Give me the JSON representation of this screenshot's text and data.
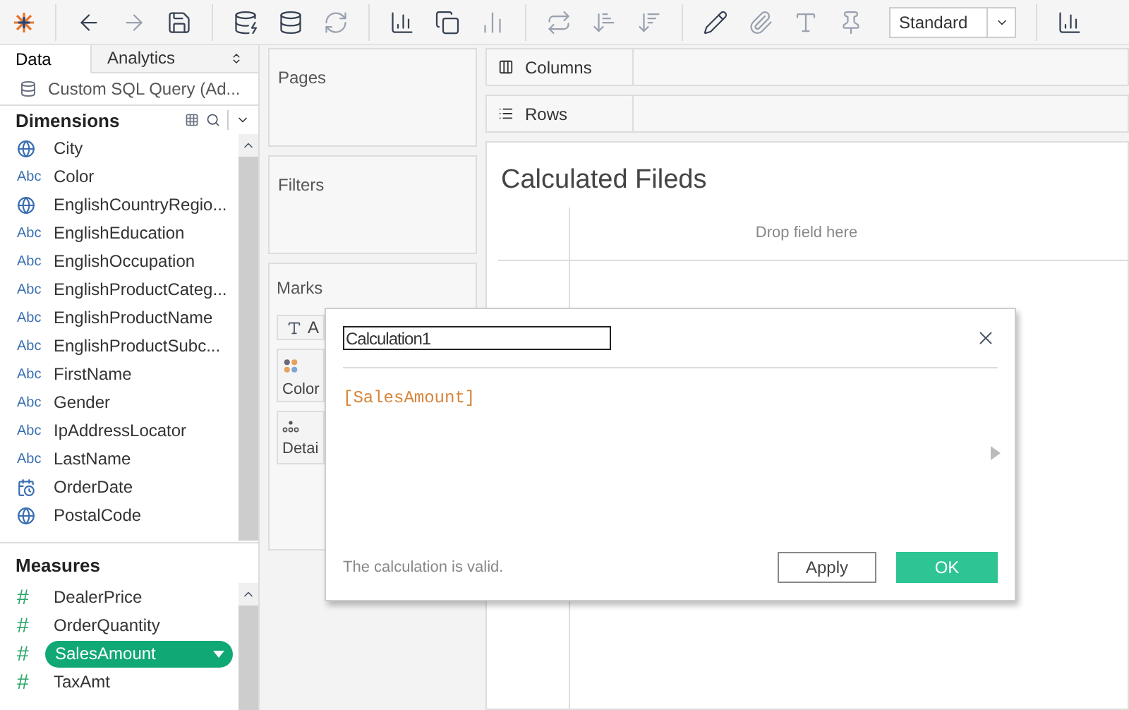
{
  "toolbar": {
    "view_mode": "Standard"
  },
  "data_pane": {
    "tabs": [
      {
        "label": "Data",
        "selected": true
      },
      {
        "label": "Analytics",
        "selected": false
      }
    ],
    "data_source": "Custom SQL Query (Ad...",
    "dimensions": {
      "title": "Dimensions",
      "fields": [
        {
          "kind": "geo",
          "name": "City",
          "selected": false
        },
        {
          "kind": "string",
          "glyph": "Abc",
          "name": "Color",
          "selected": false
        },
        {
          "kind": "geo",
          "name": "EnglishCountryRegio...",
          "selected": false
        },
        {
          "kind": "string",
          "glyph": "Abc",
          "name": "EnglishEducation",
          "selected": false
        },
        {
          "kind": "string",
          "glyph": "Abc",
          "name": "EnglishOccupation",
          "selected": false
        },
        {
          "kind": "string",
          "glyph": "Abc",
          "name": "EnglishProductCateg...",
          "selected": false
        },
        {
          "kind": "string",
          "glyph": "Abc",
          "name": "EnglishProductName",
          "selected": false
        },
        {
          "kind": "string",
          "glyph": "Abc",
          "name": "EnglishProductSubc...",
          "selected": false
        },
        {
          "kind": "string",
          "glyph": "Abc",
          "name": "FirstName",
          "selected": false
        },
        {
          "kind": "string",
          "glyph": "Abc",
          "name": "Gender",
          "selected": false
        },
        {
          "kind": "string",
          "glyph": "Abc",
          "name": "IpAddressLocator",
          "selected": false
        },
        {
          "kind": "string",
          "glyph": "Abc",
          "name": "LastName",
          "selected": false
        },
        {
          "kind": "date",
          "name": "OrderDate",
          "selected": false
        },
        {
          "kind": "geo",
          "name": "PostalCode",
          "selected": false
        }
      ]
    },
    "measures": {
      "title": "Measures",
      "fields": [
        {
          "kind": "number",
          "glyph": "#",
          "name": "DealerPrice",
          "selected": false
        },
        {
          "kind": "number",
          "glyph": "#",
          "name": "OrderQuantity",
          "selected": false
        },
        {
          "kind": "number",
          "glyph": "#",
          "name": "SalesAmount",
          "selected": true
        },
        {
          "kind": "number",
          "glyph": "#",
          "name": "TaxAmt",
          "selected": false
        }
      ]
    }
  },
  "cards": {
    "pages": "Pages",
    "filters": "Filters",
    "marks": {
      "title": "Marks",
      "items": [
        {
          "kind": "type",
          "label": "A"
        },
        {
          "kind": "color",
          "label": "Color"
        },
        {
          "kind": "detail",
          "label": "Detai"
        }
      ]
    }
  },
  "shelves": {
    "columns": "Columns",
    "rows": "Rows"
  },
  "view": {
    "title": "Calculated Fileds",
    "drop_hint": "Drop field here"
  },
  "dialog": {
    "name": "Calculation1",
    "formula": "[SalesAmount]",
    "status": "The calculation is valid.",
    "buttons": [
      {
        "kind": "secondary",
        "label": "Apply"
      },
      {
        "kind": "primary",
        "label": "OK"
      }
    ]
  }
}
